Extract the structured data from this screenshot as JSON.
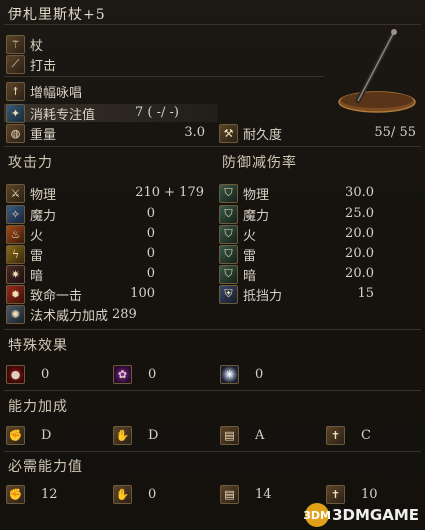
{
  "title": "伊札里斯杖+5",
  "info": {
    "weapon_type": "杖",
    "attack_type": "打击",
    "skill": "增幅咏唱",
    "fp_label": "消耗专注值",
    "fp_value": "7 (  -/  -)",
    "weight_label": "重量",
    "weight_value": "3.0",
    "durability_label": "耐久度",
    "durability_value": "55/    55"
  },
  "attack": {
    "header": "攻击力",
    "rows": [
      {
        "label": "物理",
        "value": "210 +  179",
        "icon": "sword-icon"
      },
      {
        "label": "魔力",
        "value": "0",
        "icon": "magic-icon"
      },
      {
        "label": "火",
        "value": "0",
        "icon": "fire-icon"
      },
      {
        "label": "雷",
        "value": "0",
        "icon": "lightning-icon"
      },
      {
        "label": "暗",
        "value": "0",
        "icon": "dark-icon"
      },
      {
        "label": "致命一击",
        "value": "100",
        "icon": "critical-icon"
      },
      {
        "label": "法术威力加成",
        "value": "289",
        "icon": "spellbuff-icon"
      }
    ]
  },
  "defense": {
    "header": "防御减伤率",
    "rows": [
      {
        "label": "物理",
        "value": "30.0",
        "icon": "shield-icon"
      },
      {
        "label": "魔力",
        "value": "25.0",
        "icon": "magic-shield-icon"
      },
      {
        "label": "火",
        "value": "20.0",
        "icon": "fire-shield-icon"
      },
      {
        "label": "雷",
        "value": "20.0",
        "icon": "lightning-shield-icon"
      },
      {
        "label": "暗",
        "value": "20.0",
        "icon": "dark-shield-icon"
      },
      {
        "label": "抵挡力",
        "value": "15",
        "icon": "stability-icon"
      }
    ]
  },
  "effects": {
    "header": "特殊效果",
    "items": [
      {
        "value": "0",
        "icon": "bleed-icon",
        "color": "#b01818"
      },
      {
        "value": "0",
        "icon": "poison-icon",
        "color": "#8a2a9a"
      },
      {
        "value": "0",
        "icon": "frost-icon",
        "color": "#d8e8ff"
      }
    ]
  },
  "scaling": {
    "header": "能力加成",
    "items": [
      {
        "value": "D",
        "icon": "strength-icon"
      },
      {
        "value": "D",
        "icon": "dexterity-icon"
      },
      {
        "value": "A",
        "icon": "intelligence-icon"
      },
      {
        "value": "C",
        "icon": "faith-icon"
      }
    ]
  },
  "requirements": {
    "header": "必需能力值",
    "items": [
      {
        "value": "12",
        "icon": "strength-icon"
      },
      {
        "value": "0",
        "icon": "dexterity-icon"
      },
      {
        "value": "14",
        "icon": "intelligence-icon"
      },
      {
        "value": "10",
        "icon": "faith-icon"
      }
    ]
  },
  "watermark": {
    "logo": "3DM",
    "brand": "3DMGAME"
  }
}
